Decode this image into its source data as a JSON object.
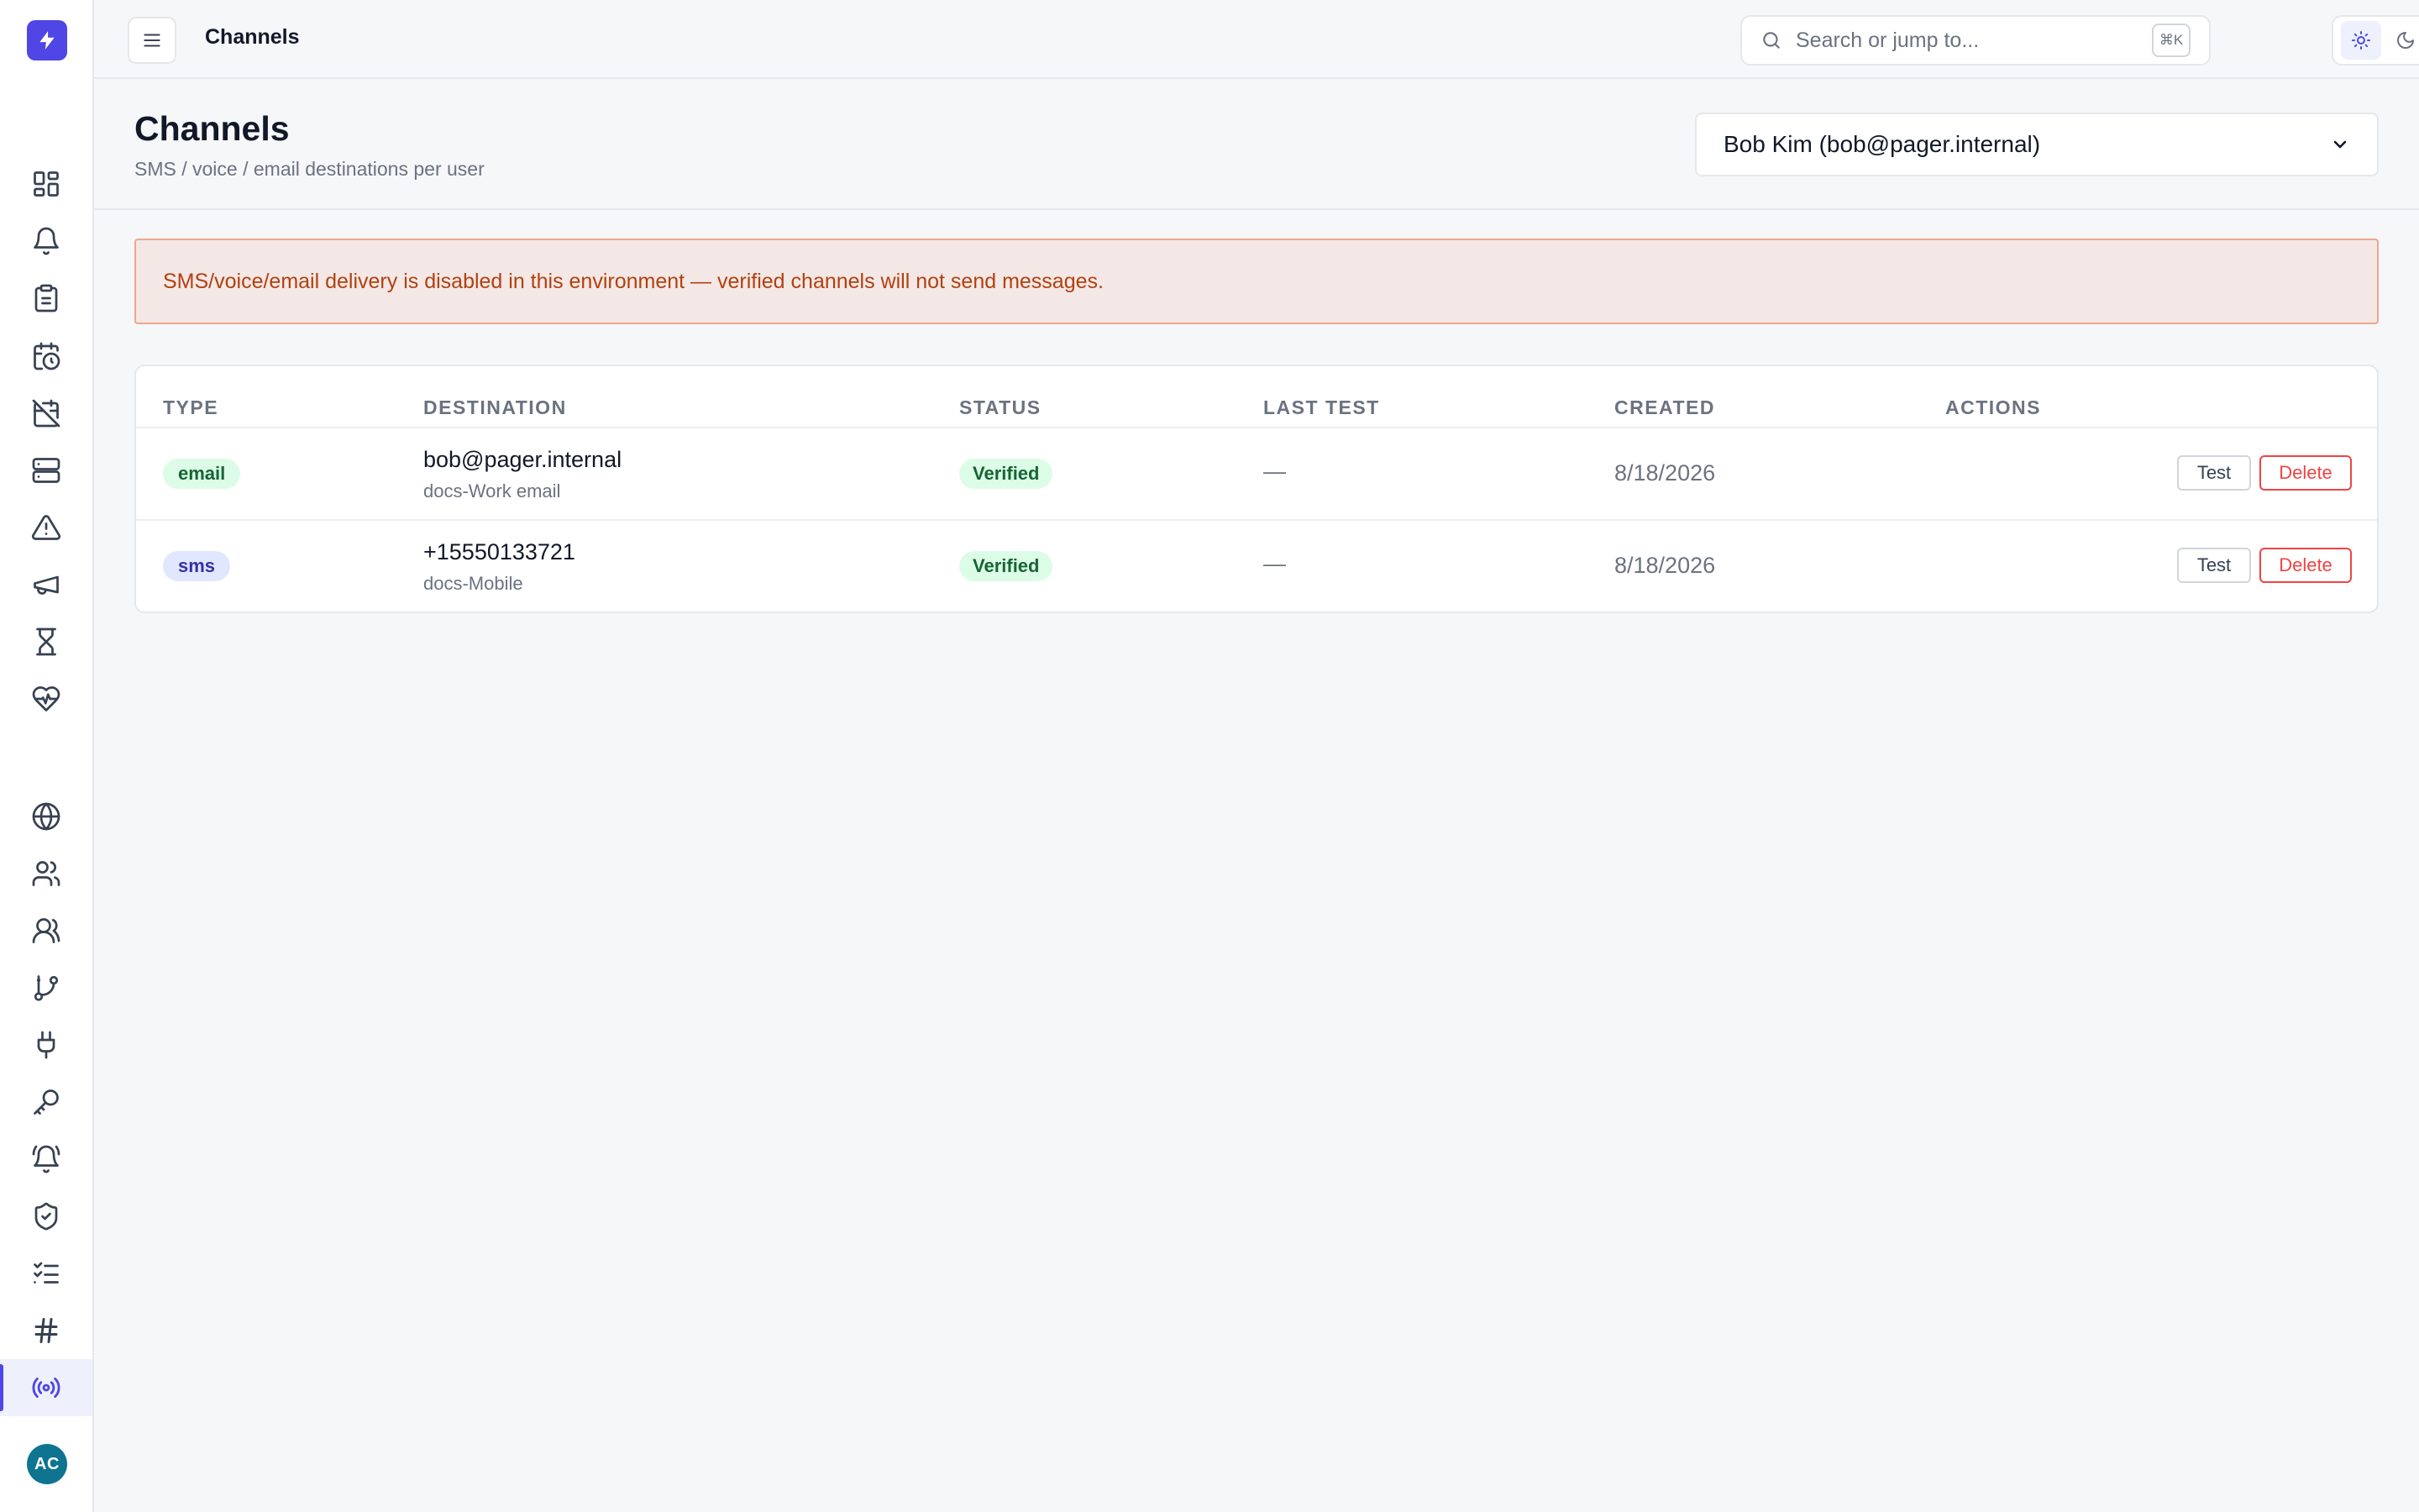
{
  "topbar": {
    "title": "Channels",
    "search_placeholder": "Search or jump to...",
    "search_shortcut": "⌘K",
    "theme_options": [
      "light-icon",
      "dark-icon",
      "system-icon"
    ],
    "active_theme": "light"
  },
  "sidebar": {
    "logo_icon": "bolt-icon",
    "items": [
      {
        "name": "dashboard",
        "icon": "grid-icon"
      },
      {
        "name": "alerts",
        "icon": "bell-icon"
      },
      {
        "name": "incidents",
        "icon": "clipboard-icon"
      },
      {
        "name": "schedules",
        "icon": "calendar-clock-icon"
      },
      {
        "name": "calendar-off",
        "icon": "calendar-off-icon"
      },
      {
        "name": "services",
        "icon": "server-icon"
      },
      {
        "name": "warnings",
        "icon": "warning-icon"
      },
      {
        "name": "announcements",
        "icon": "megaphone-icon"
      },
      {
        "name": "timers",
        "icon": "hourglass-icon"
      },
      {
        "name": "health",
        "icon": "heart-pulse-icon"
      },
      {
        "name": "global",
        "icon": "globe-icon"
      },
      {
        "name": "users",
        "icon": "user-pair-icon"
      },
      {
        "name": "teams",
        "icon": "users-icon"
      },
      {
        "name": "escalations",
        "icon": "git-branch-icon"
      },
      {
        "name": "integrations",
        "icon": "plug-icon"
      },
      {
        "name": "keys",
        "icon": "key-icon"
      },
      {
        "name": "notifications",
        "icon": "bell-ring-icon"
      },
      {
        "name": "security",
        "icon": "shield-check-icon"
      },
      {
        "name": "tasks",
        "icon": "list-checks-icon"
      },
      {
        "name": "slack",
        "icon": "hash-icon"
      },
      {
        "name": "channels",
        "icon": "radio-icon",
        "active": true
      }
    ],
    "avatar_initials": "AC"
  },
  "page": {
    "title": "Channels",
    "subtitle": "SMS / voice / email destinations per user",
    "user_select": "Bob Kim (bob@pager.internal)"
  },
  "alert": {
    "text": "SMS/voice/email delivery is disabled in this environment — verified channels will not send messages."
  },
  "table": {
    "headers": [
      "TYPE",
      "DESTINATION",
      "STATUS",
      "LAST TEST",
      "CREATED",
      "ACTIONS"
    ],
    "rows": [
      {
        "type": "email",
        "destination": "bob@pager.internal",
        "label": "docs-Work email",
        "status": "Verified",
        "last_test": "—",
        "created": "8/18/2026",
        "test_label": "Test",
        "delete_label": "Delete"
      },
      {
        "type": "sms",
        "destination": "+15550133721",
        "label": "docs-Mobile",
        "status": "Verified",
        "last_test": "—",
        "created": "8/18/2026",
        "test_label": "Test",
        "delete_label": "Delete"
      }
    ]
  },
  "colors": {
    "accent": "#4f46e5",
    "alert_bg": "#f3e8e6",
    "alert_text": "#b3400f",
    "verified": "#166534",
    "danger": "#ef4444"
  }
}
